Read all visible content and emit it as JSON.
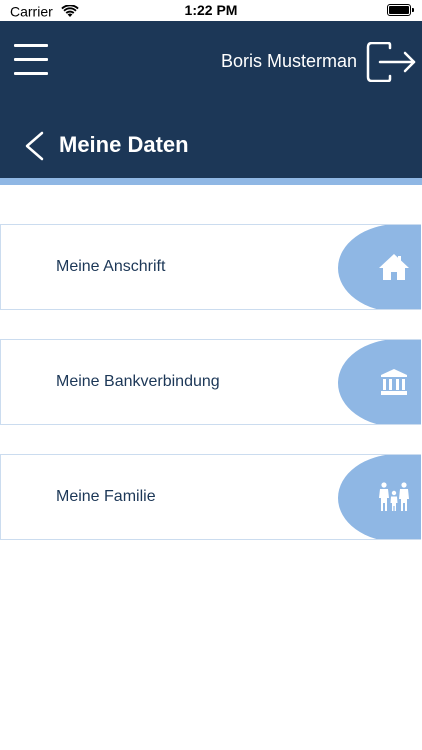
{
  "status_bar": {
    "carrier": "Carrier",
    "time": "1:22 PM"
  },
  "header": {
    "user_name": "Boris Musterman",
    "title": "Meine Daten",
    "background_color": "#1c3757",
    "accent_color": "#8fb7e4"
  },
  "menu": {
    "items": [
      {
        "label": "Meine Anschrift",
        "icon": "house-icon"
      },
      {
        "label": "Meine Bankverbindung",
        "icon": "bank-icon"
      },
      {
        "label": "Meine Familie",
        "icon": "family-icon"
      }
    ]
  }
}
